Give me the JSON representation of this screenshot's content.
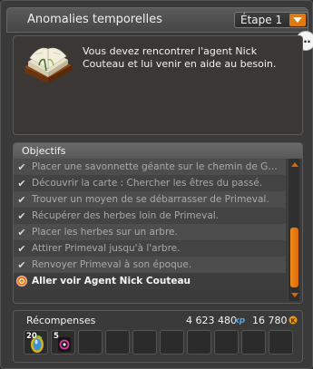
{
  "window": {
    "title": "Anomalies temporelles",
    "stage_select": {
      "value": "Étape 1"
    }
  },
  "description": {
    "text": "Vous devez rencontrer l'agent Nick Couteau et lui venir en aide au besoin."
  },
  "objectives": {
    "header": "Objectifs",
    "items": [
      {
        "label": "Placer une savonnette géante sur le chemin de G…",
        "done": true
      },
      {
        "label": "Découvrir la carte : Chercher les êtres du passé.",
        "done": true
      },
      {
        "label": "Trouver un moyen de se débarrasser de Primeval.",
        "done": true
      },
      {
        "label": "Récupérer des herbes loin de Primeval.",
        "done": true
      },
      {
        "label": "Placer les herbes sur un arbre.",
        "done": true
      },
      {
        "label": "Attirer Primeval jusqu'à l'arbre.",
        "done": true
      },
      {
        "label": "Renvoyer Primeval à son époque.",
        "done": true
      },
      {
        "label": "Aller voir Agent Nick Couteau",
        "done": false,
        "active": true
      }
    ]
  },
  "rewards": {
    "title": "Récompenses",
    "xp": "4 623 480",
    "kamas": "16 780",
    "items": [
      {
        "qty": "20",
        "icon": "crystal-item-icon"
      },
      {
        "qty": "5",
        "icon": "dark-orb-item-icon"
      }
    ],
    "empty_slots": 8
  },
  "colors": {
    "accent": "#e07a12",
    "panel_bg": "#3a3a3a",
    "text": "#f2f2f2",
    "text_done": "#a9a9a9"
  }
}
